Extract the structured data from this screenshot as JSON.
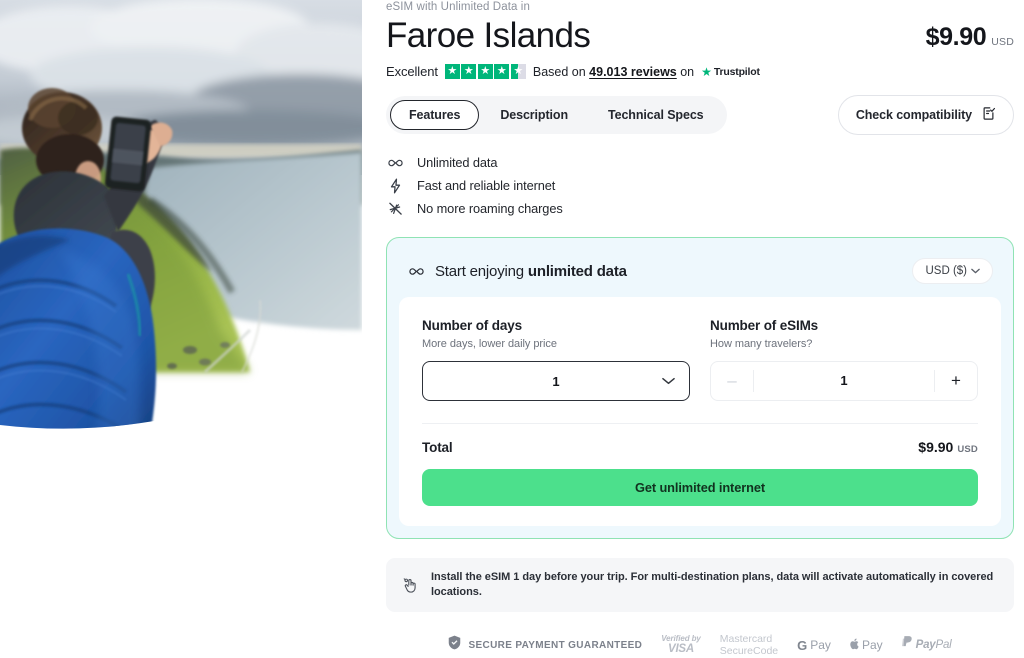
{
  "hero": {
    "alt": "woman-photographing-fjord-landscape"
  },
  "header": {
    "eyebrow": "eSIM with Unlimited Data in",
    "title": "Faroe Islands",
    "price": "$9.90",
    "price_currency": "USD"
  },
  "rating": {
    "word": "Excellent",
    "stars_full": 4,
    "stars_partial_pct": 45,
    "based_on": "Based on",
    "reviews_link": "49.013 reviews",
    "on": "on",
    "provider": "Trustpilot",
    "star_color": "#00b67a"
  },
  "tabs": [
    {
      "label": "Features",
      "active": true
    },
    {
      "label": "Description",
      "active": false
    },
    {
      "label": "Technical Specs",
      "active": false
    }
  ],
  "compatibility": {
    "label": "Check compatibility",
    "icon": "document-check-icon"
  },
  "features": [
    {
      "icon": "infinity-icon",
      "label": "Unlimited data"
    },
    {
      "icon": "lightning-bolt-icon",
      "label": "Fast and reliable internet"
    },
    {
      "icon": "no-roaming-icon",
      "label": "No more roaming charges"
    }
  ],
  "buy_card": {
    "icon": "infinity-icon",
    "title_prefix": "Start enjoying ",
    "title_strong": "unlimited data",
    "currency_selector": "USD ($)",
    "border_color": "#8fe3b4",
    "header_bg": "#eef8fd",
    "days": {
      "label": "Number of days",
      "sublabel": "More days, lower daily price",
      "value": "1"
    },
    "esims": {
      "label": "Number of eSIMs",
      "sublabel": "How many travelers?",
      "value": "1",
      "minus": "–",
      "plus": "+"
    },
    "total": {
      "label": "Total",
      "price": "$9.90",
      "currency": "USD"
    },
    "cta": {
      "label": "Get unlimited internet",
      "color": "#4ce08c"
    }
  },
  "notice": {
    "icon": "hand-tap-icon",
    "text": "Install the eSIM 1 day before your trip. For multi-destination plans, data will activate automatically in covered locations."
  },
  "payments": {
    "secure_label": "SECURE PAYMENT GUARANTEED",
    "secure_icon": "shield-check-icon",
    "visa_top": "Verified by",
    "visa_bottom": "VISA",
    "mastercard_line1": "Mastercard",
    "mastercard_line2": "SecureCode",
    "gpay_g": "G",
    "gpay_pay": "Pay",
    "apay_pay": "Pay",
    "paypal_pay": "Pay",
    "paypal_pal": "Pal"
  }
}
